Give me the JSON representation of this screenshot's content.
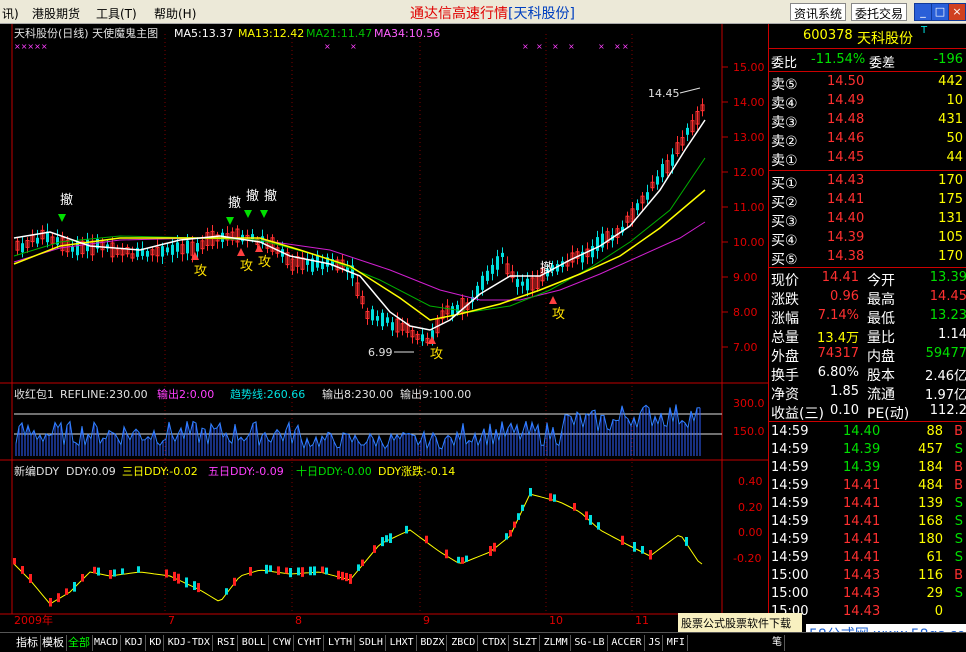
{
  "menu": {
    "items": [
      "讯)",
      "港股期货",
      "工具(T)",
      "帮助(H)"
    ]
  },
  "app_title": "通达信高速行情",
  "stock_title": "[天科股份]",
  "sys_buttons": [
    "资讯系统",
    "委托交易"
  ],
  "window_buttons": [
    "_",
    "□",
    "×"
  ],
  "main_chart": {
    "header": {
      "name": "天科股份(日线) 天使魔鬼主图",
      "ma5": "MA5:13.37",
      "ma13": "MA13:12.42",
      "ma21": "MA21:11.47",
      "ma34": "MA34:10.56"
    },
    "y_ticks": [
      "15.00",
      "14.00",
      "13.00",
      "12.00",
      "11.00",
      "10.00",
      "9.00",
      "8.00",
      "7.00"
    ],
    "high_label": "14.45",
    "low_label": "6.99",
    "sell_label": "撤",
    "buy_label": "攻"
  },
  "sub1": {
    "header": {
      "name": "收红包1",
      "refline": "REFLINE:230.00",
      "out2": "输出2:0.00",
      "trend": "趋势线:260.66",
      "out8": "输出8:230.00",
      "out9": "输出9:100.00"
    },
    "y_ticks": [
      "300.0",
      "150.0"
    ]
  },
  "sub2": {
    "header": {
      "name": "新编DDY",
      "ddy": "DDY:0.09",
      "three": "三日DDY:-0.02",
      "five": "五日DDY:-0.09",
      "ten": "十日DDY:-0.00",
      "zd": "DDY涨跌:-0.14"
    },
    "y_ticks": [
      "0.40",
      "0.20",
      "0.00",
      "-0.20"
    ]
  },
  "x_labels": [
    "2009年",
    "7",
    "8",
    "9",
    "10",
    "11"
  ],
  "quote": {
    "code": "600378",
    "name": "天科股份",
    "t_mark": "T",
    "weibi_label": "委比",
    "weibi": "-11.54%",
    "weicha_label": "委差",
    "weicha": "-196",
    "asks": [
      {
        "label": "卖⑤",
        "price": "14.50",
        "vol": "442"
      },
      {
        "label": "卖④",
        "price": "14.49",
        "vol": "10"
      },
      {
        "label": "卖③",
        "price": "14.48",
        "vol": "431"
      },
      {
        "label": "卖②",
        "price": "14.46",
        "vol": "50"
      },
      {
        "label": "卖①",
        "price": "14.45",
        "vol": "44"
      }
    ],
    "bids": [
      {
        "label": "买①",
        "price": "14.43",
        "vol": "170"
      },
      {
        "label": "买②",
        "price": "14.41",
        "vol": "175"
      },
      {
        "label": "买③",
        "price": "14.40",
        "vol": "131"
      },
      {
        "label": "买④",
        "price": "14.39",
        "vol": "105"
      },
      {
        "label": "买⑤",
        "price": "14.38",
        "vol": "170"
      }
    ],
    "stats": [
      {
        "l1": "现价",
        "v1": "14.41",
        "l2": "今开",
        "v2": "13.39"
      },
      {
        "l1": "涨跌",
        "v1": "0.96",
        "l2": "最高",
        "v2": "14.45"
      },
      {
        "l1": "涨幅",
        "v1": "7.14%",
        "l2": "最低",
        "v2": "13.23"
      },
      {
        "l1": "总量",
        "v1": "13.4万",
        "l2": "量比",
        "v2": "1.14"
      },
      {
        "l1": "外盘",
        "v1": "74317",
        "l2": "内盘",
        "v2": "59477"
      },
      {
        "l1": "换手",
        "v1": "6.80%",
        "l2": "股本",
        "v2": "2.46亿"
      },
      {
        "l1": "净资",
        "v1": "1.85",
        "l2": "流通",
        "v2": "1.97亿"
      },
      {
        "l1": "收益(三)",
        "v1": "0.10",
        "l2": "PE(动)",
        "v2": "112.2"
      }
    ],
    "ticks": [
      {
        "time": "14:59",
        "price": "14.40",
        "vol": "88",
        "side": "B"
      },
      {
        "time": "14:59",
        "price": "14.39",
        "vol": "457",
        "side": "S"
      },
      {
        "time": "14:59",
        "price": "14.39",
        "vol": "184",
        "side": "B"
      },
      {
        "time": "14:59",
        "price": "14.41",
        "vol": "484",
        "side": "B"
      },
      {
        "time": "14:59",
        "price": "14.41",
        "vol": "139",
        "side": "S"
      },
      {
        "time": "14:59",
        "price": "14.41",
        "vol": "168",
        "side": "S"
      },
      {
        "time": "14:59",
        "price": "14.41",
        "vol": "180",
        "side": "S"
      },
      {
        "time": "14:59",
        "price": "14.41",
        "vol": "61",
        "side": "S"
      },
      {
        "time": "15:00",
        "price": "14.43",
        "vol": "116",
        "side": "B"
      },
      {
        "time": "15:00",
        "price": "14.43",
        "vol": "29",
        "side": "S"
      },
      {
        "time": "15:00",
        "price": "14.43",
        "vol": "0",
        "side": ""
      }
    ]
  },
  "tabs": [
    "指标",
    "模板",
    "全部",
    "MACD",
    "KDJ",
    "KD",
    "KDJ-TDX",
    "RSI",
    "BOLL",
    "CYW",
    "CYHT",
    "LYTH",
    "SDLH",
    "LHXT",
    "BDZX",
    "ZBCD",
    "CTDX",
    "SLZT",
    "ZLMM",
    "SG-LB",
    "ACCER",
    "JS",
    "MFI"
  ],
  "bottom_tabs_right": [
    "笔"
  ],
  "ad_text": "股票公式股票软件下载",
  "watermark": "58公式网 www.58gs.com",
  "colors": {
    "up": "#ff3030",
    "down": "#00e0e0",
    "ma5": "#ffffff",
    "ma13": "#ffff00",
    "ma21": "#00c000",
    "ma34": "#ff00ff",
    "accent": "#c00000"
  }
}
